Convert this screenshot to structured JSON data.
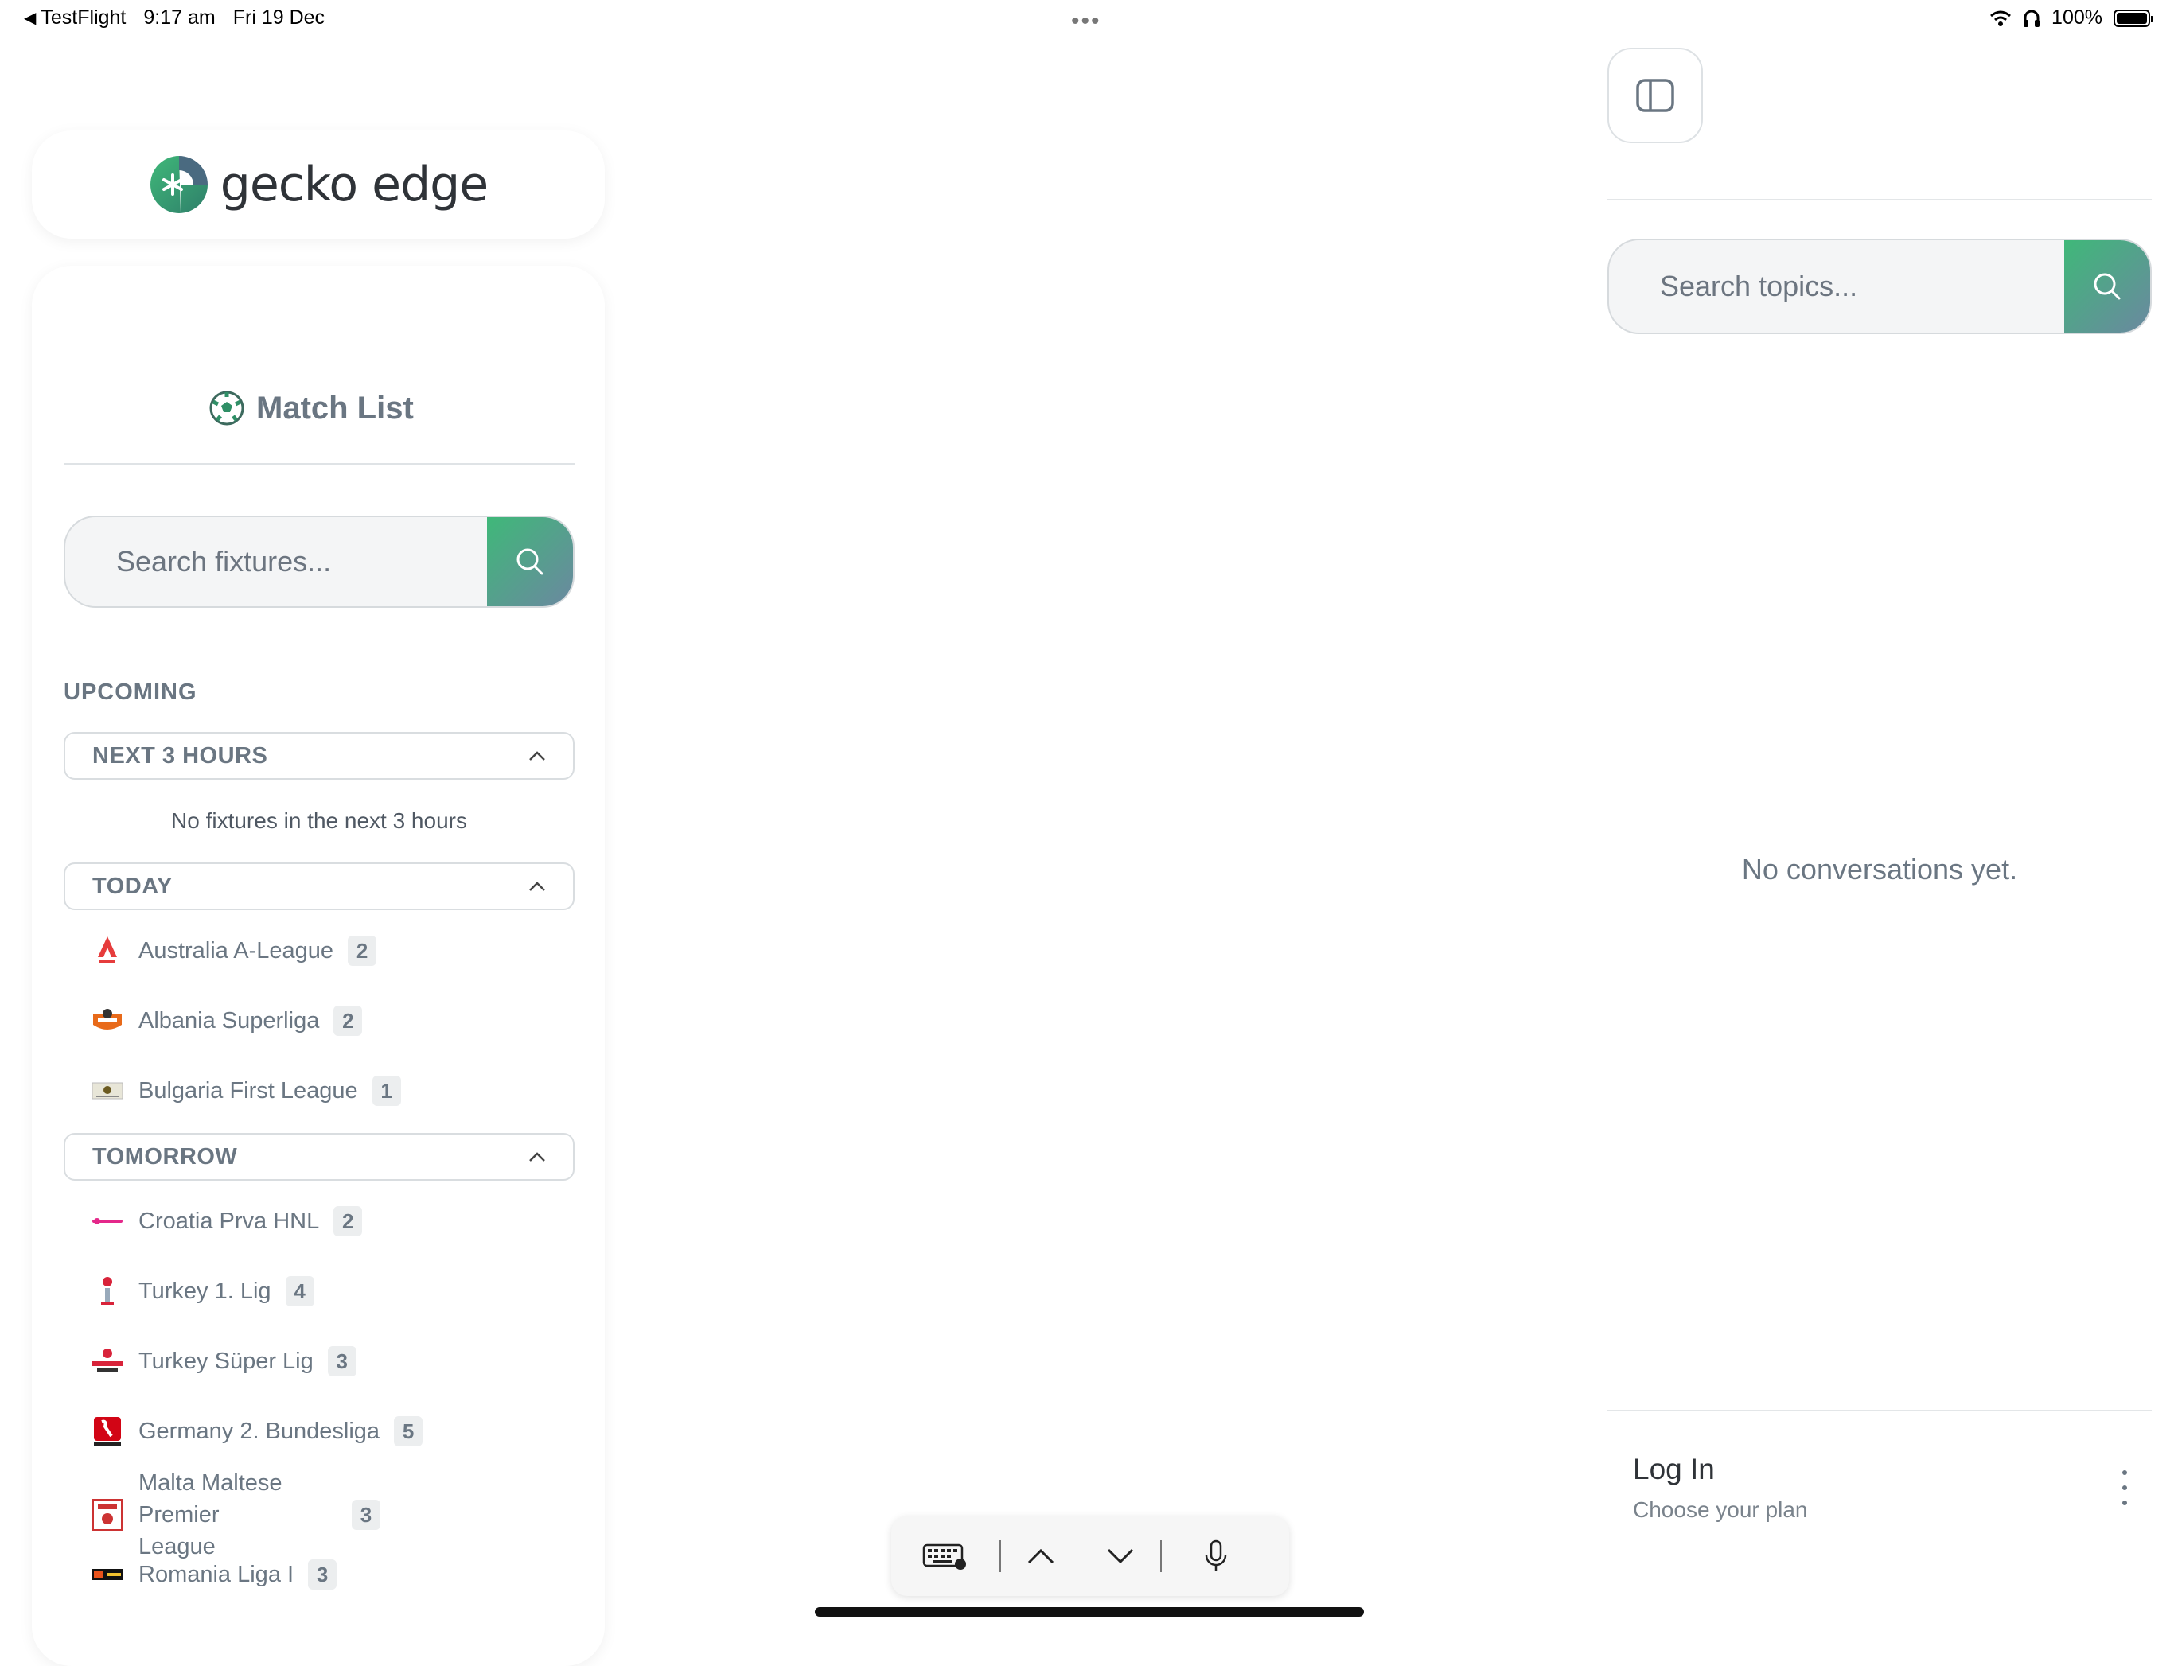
{
  "status_bar": {
    "back_app": "TestFlight",
    "time": "9:17 am",
    "date": "Fri 19 Dec",
    "battery": "100%",
    "battery_level": 1.0
  },
  "brand": {
    "name": "gecko edge"
  },
  "sidebar": {
    "title": "Match List",
    "search_placeholder": "Search fixtures...",
    "section_label": "UPCOMING",
    "groups": [
      {
        "label": "NEXT 3 HOURS",
        "empty_message": "No fixtures in the next 3 hours"
      },
      {
        "label": "TODAY"
      },
      {
        "label": "TOMORROW"
      }
    ],
    "leagues_today": [
      {
        "name": "Australia A-League",
        "count": "2"
      },
      {
        "name": "Albania Superliga",
        "count": "2"
      },
      {
        "name": "Bulgaria First League",
        "count": "1"
      }
    ],
    "leagues_tomorrow": [
      {
        "name": "Croatia Prva HNL",
        "count": "2"
      },
      {
        "name": "Turkey 1. Lig",
        "count": "4"
      },
      {
        "name": "Turkey Süper Lig",
        "count": "3"
      },
      {
        "name": "Germany 2. Bundesliga",
        "count": "5"
      },
      {
        "name_line1": "Malta Maltese Premier",
        "name_line2": "League",
        "count": "3"
      },
      {
        "name": "Romania Liga I",
        "count": "3"
      }
    ]
  },
  "chat_panel": {
    "search_placeholder": "Search topics...",
    "empty_message": "No conversations yet.",
    "login_title": "Log In",
    "login_subtitle": "Choose your plan"
  },
  "colors": {
    "accent_green": "#3fb879",
    "accent_slate": "#6b88a0",
    "text_muted": "#6a7682"
  }
}
